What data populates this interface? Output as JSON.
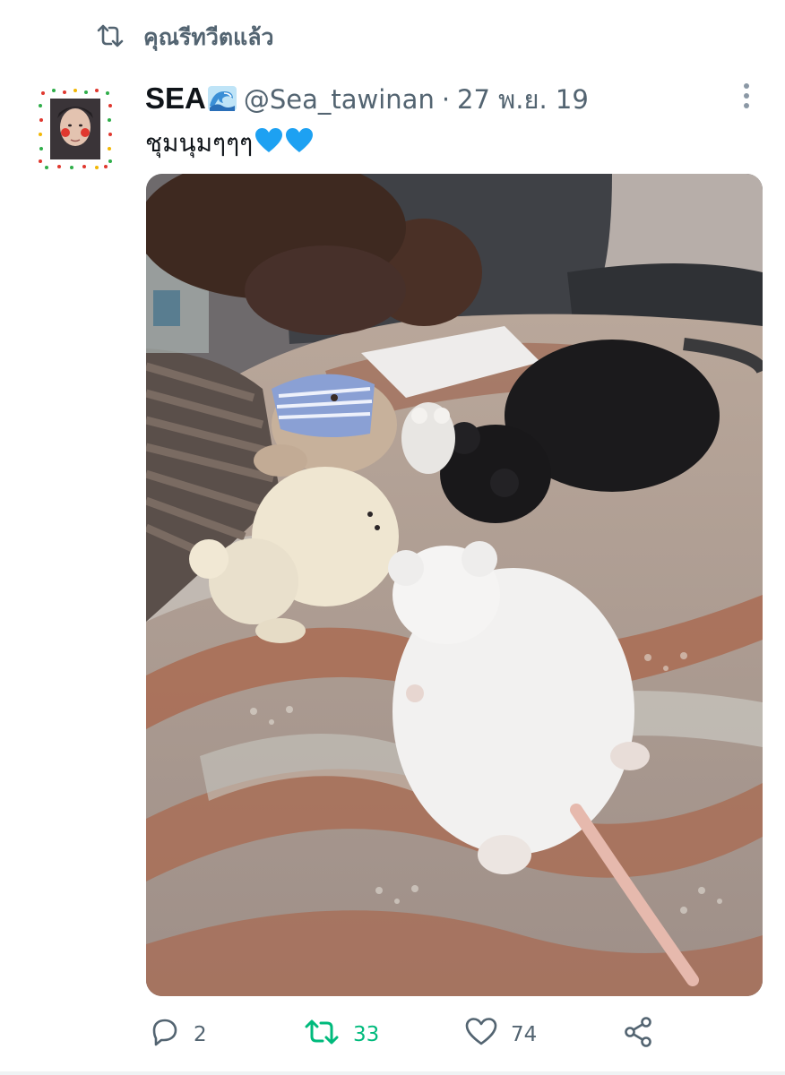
{
  "retweet_banner": {
    "icon": "retweet-icon",
    "text": "คุณรีทวีตแล้ว"
  },
  "tweet": {
    "display_name": "SEA",
    "name_emoji": "wave-emoji",
    "handle": "@Sea_tawinan",
    "separator": "·",
    "date": "27 พ.ย. 19",
    "text": "ชุมนุมๆๆๆ",
    "text_emoji": [
      "blue-heart-emoji",
      "blue-heart-emoji"
    ],
    "media": {
      "type": "photo",
      "alt": ""
    },
    "actions": {
      "reply_count": "2",
      "retweet_count": "33",
      "like_count": "74",
      "retweeted": true
    }
  },
  "colors": {
    "text_primary": "#0f1419",
    "text_secondary": "#536471",
    "retweet_active": "#00ba7c",
    "heart_blue": "#1da1f2"
  }
}
